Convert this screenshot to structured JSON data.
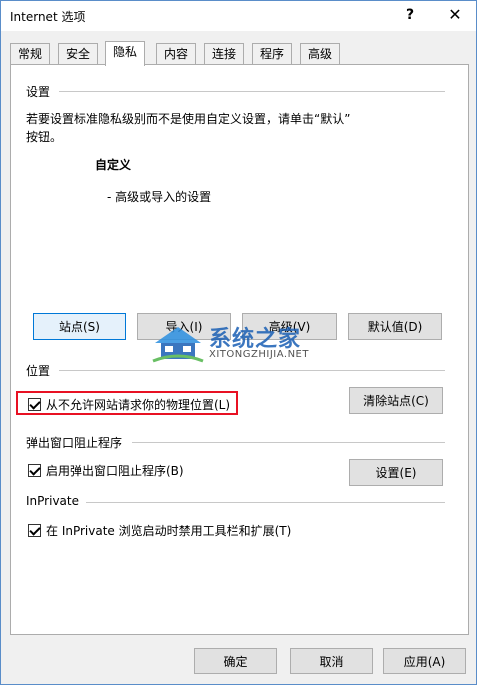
{
  "window": {
    "title": "Internet 选项",
    "help_label": "?",
    "close_label": "✕"
  },
  "tabs": [
    {
      "label": "常规"
    },
    {
      "label": "安全"
    },
    {
      "label": "隐私",
      "active": true
    },
    {
      "label": "内容"
    },
    {
      "label": "连接"
    },
    {
      "label": "程序"
    },
    {
      "label": "高级"
    }
  ],
  "settings": {
    "group_label": "设置",
    "description_line1": "若要设置标准隐私级别而不是使用自定义设置，请单击“默认”",
    "description_line2": "按钮。",
    "level_title": "自定义",
    "level_detail": "- 高级或导入的设置",
    "sites_button": "站点(S)",
    "import_button": "导入(I)",
    "advanced_button": "高级(V)",
    "default_button": "默认值(D)"
  },
  "location": {
    "group_label": "位置",
    "checkbox_label": "从不允许网站请求你的物理位置(L)",
    "checked": true,
    "clear_sites_button": "清除站点(C)"
  },
  "popup": {
    "group_label": "弹出窗口阻止程序",
    "checkbox_label": "启用弹出窗口阻止程序(B)",
    "checked": true,
    "settings_button": "设置(E)"
  },
  "inprivate": {
    "group_label": "InPrivate",
    "checkbox_label": "在 InPrivate 浏览启动时禁用工具栏和扩展(T)",
    "checked": true
  },
  "footer": {
    "ok_button": "确定",
    "cancel_button": "取消",
    "apply_button": "应用(A)"
  },
  "watermark": {
    "brand_cn": "系统之家",
    "brand_en": "XITONGZHIJIA.NET"
  },
  "colors": {
    "highlight": "#e81123",
    "focus_border": "#0078d7"
  }
}
